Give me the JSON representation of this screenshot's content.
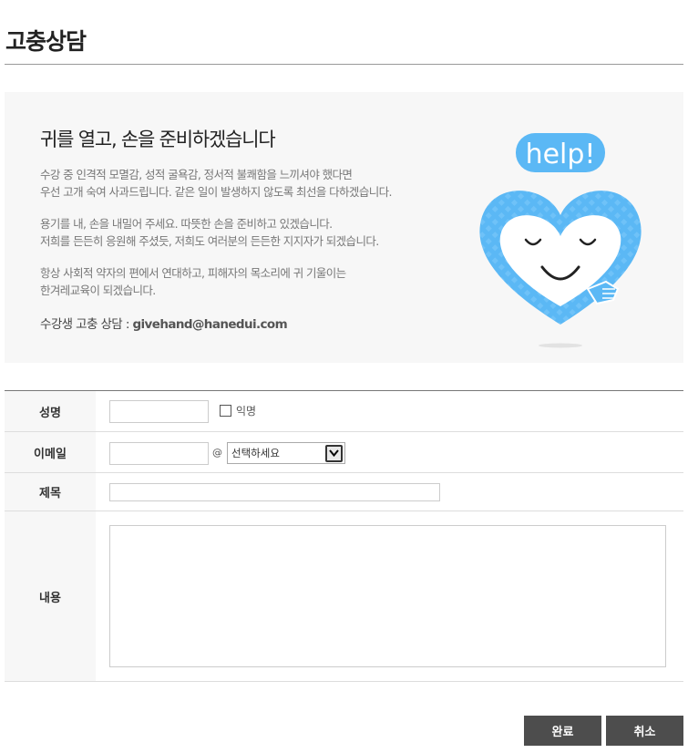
{
  "page": {
    "title": "고충상담"
  },
  "intro": {
    "heading": "귀를 열고, 손을 준비하겠습니다",
    "paragraph1": [
      "수강 중 인격적 모멸감, 성적 굴욕감, 정서적 불쾌함을 느끼셔야 했다면",
      "우선 고개 숙여 사과드립니다. 같은 일이 발생하지 않도록 최선을 다하겠습니다."
    ],
    "paragraph2": [
      "용기를 내, 손을 내밀어 주세요. 따뜻한 손을 준비하고 있겠습니다.",
      "저희를 든든히 응원해 주셨듯, 저희도 여러분의 든든한 지지자가 되겠습니다."
    ],
    "paragraph3": [
      "항상 사회적 약자의 편에서 연대하고, 피해자의 목소리에 귀 기울이는",
      "한겨레교육이 되겠습니다."
    ],
    "contact_label": "수강생 고충 상담 : ",
    "contact_email": "givehand@hanedui.com",
    "illustration_text": "help!",
    "illustration_color": "#5bb8f5"
  },
  "form": {
    "name": {
      "label": "성명",
      "value": "",
      "anonymous_label": "익명",
      "anonymous_checked": false
    },
    "email": {
      "label": "이메일",
      "value": "",
      "at": "@",
      "domain_selected": "선택하세요"
    },
    "subject": {
      "label": "제목",
      "value": ""
    },
    "content": {
      "label": "내용",
      "value": ""
    }
  },
  "buttons": {
    "submit": "완료",
    "cancel": "취소"
  }
}
